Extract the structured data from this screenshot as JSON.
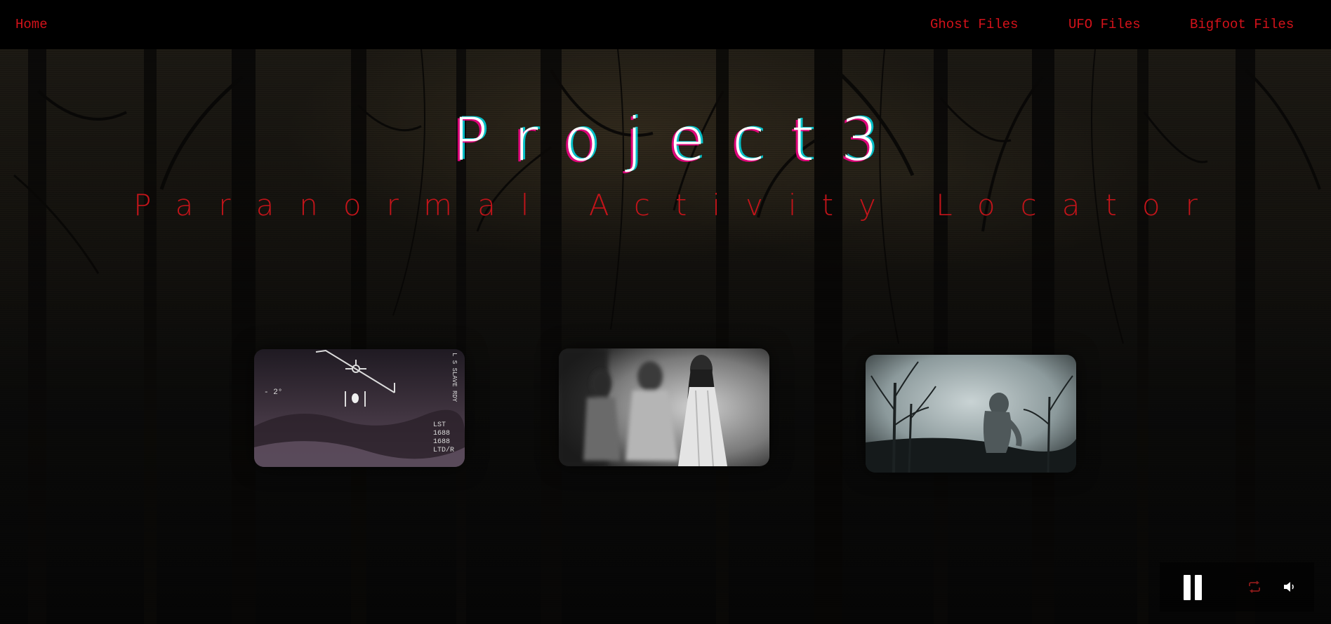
{
  "nav": {
    "home": "Home",
    "ghost": "Ghost Files",
    "ufo": "UFO Files",
    "bigfoot": "Bigfoot Files"
  },
  "hero": {
    "title": "Project3",
    "subtitle": "Paranormal Activity Locator"
  },
  "cards": {
    "ufo": {
      "overlay_texts": [
        "- 2°",
        "LST",
        "1688",
        "1688",
        "LTD/R"
      ],
      "side_text": "L S SLAVE RDY"
    },
    "ghost": {},
    "bigfoot": {}
  },
  "player": {
    "state": "playing",
    "icons": [
      "pause-icon",
      "loop-icon",
      "volume-icon"
    ],
    "loop_color": "#8a1a1a"
  },
  "colors": {
    "accent_red": "#d4121a",
    "title_white": "#ffffff",
    "nav_bg": "#000000"
  }
}
